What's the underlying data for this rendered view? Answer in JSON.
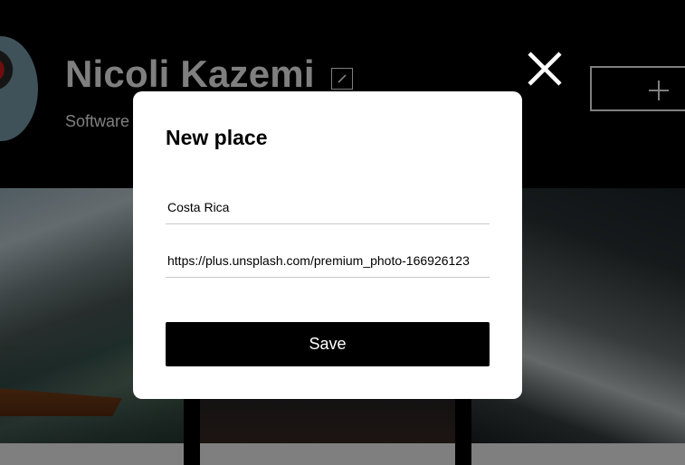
{
  "profile": {
    "name": "Nicoli Kazemi",
    "job_visible": "Software"
  },
  "icons": {
    "edit": "pencil-icon",
    "add": "plus-icon",
    "close": "close-icon"
  },
  "modal": {
    "title": "New place",
    "name_field": {
      "value": "Costa Rica"
    },
    "link_field": {
      "value": "https://plus.unsplash.com/premium_photo-166926123"
    },
    "save_label": "Save"
  },
  "colors": {
    "overlay": "rgba(0,0,0,0.5)",
    "modal_background": "#ffffff",
    "button_background": "#000000"
  }
}
